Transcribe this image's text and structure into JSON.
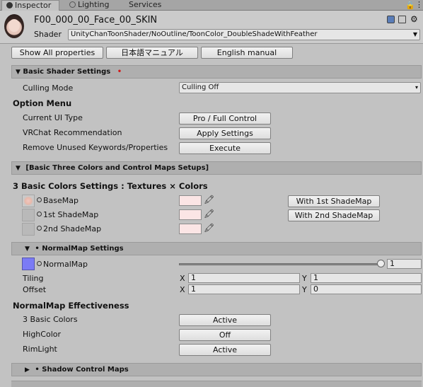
{
  "tabs": [
    {
      "label": "Inspector",
      "icon": "info-icon"
    },
    {
      "label": "Lighting",
      "icon": "lightbulb-icon"
    },
    {
      "label": "Services",
      "icon": ""
    }
  ],
  "header": {
    "title": "F00_000_00_Face_00_SKIN",
    "shader_label": "Shader",
    "shader_value": "UnityChanToonShader/NoOutline/ToonColor_DoubleShadeWithFeather"
  },
  "toolbar": {
    "show_all": "Show All properties",
    "japanese_manual": "日本語マニュアル",
    "english_manual": "English manual"
  },
  "basic": {
    "title": "Basic Shader Settings",
    "culling_label": "Culling Mode",
    "culling_value": "Culling Off"
  },
  "option": {
    "title": "Option Menu",
    "ui_type_label": "Current UI Type",
    "ui_type_button": "Pro / Full Control",
    "vrchat_label": "VRChat Recommendation",
    "vrchat_button": "Apply Settings",
    "remove_label": "Remove Unused Keywords/Properties",
    "remove_button": "Execute"
  },
  "three_colors": {
    "section_title": "[Basic Three Colors and Control Maps Setups]",
    "title": "3 Basic Colors Settings : Textures × Colors",
    "basemap": "BaseMap",
    "shade1": "1st ShadeMap",
    "shade2": "2nd ShadeMap",
    "with1": "With 1st ShadeMap",
    "with2": "With 2nd ShadeMap",
    "color": "#FBE5E5"
  },
  "normal": {
    "section_title": "• NormalMap Settings",
    "label": "NormalMap",
    "slider_value": "1",
    "tiling_label": "Tiling",
    "offset_label": "Offset",
    "x_label": "X",
    "y_label": "Y",
    "tiling_x": "1",
    "tiling_y": "1",
    "offset_x": "1",
    "offset_y": "0",
    "tex_color": "#7B7BF5"
  },
  "effectiveness": {
    "title": "NormalMap Effectiveness",
    "basic_label": "3 Basic Colors",
    "basic_value": "Active",
    "high_label": "HighColor",
    "high_value": "Off",
    "rim_label": "RimLight",
    "rim_value": "Active"
  },
  "shadow": {
    "section_title": "• Shadow Control Maps"
  }
}
